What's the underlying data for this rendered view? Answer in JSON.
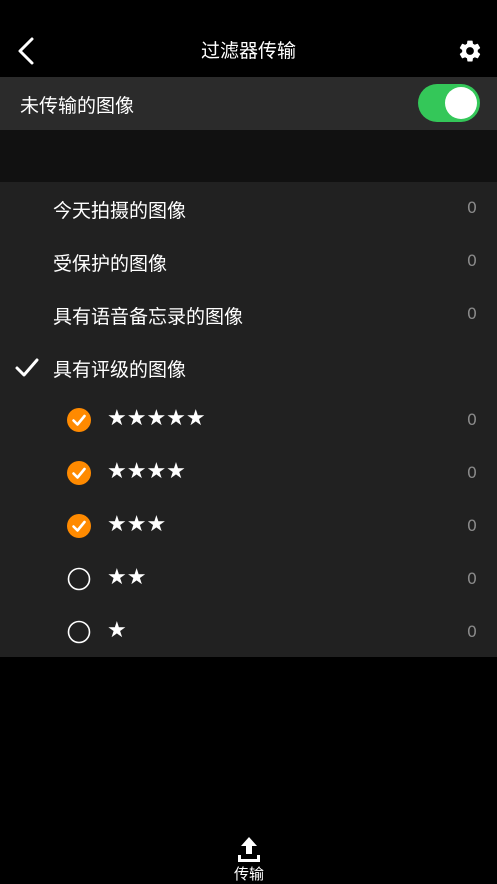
{
  "header": {
    "title": "过滤器传输"
  },
  "untransferred": {
    "label": "未传输的图像",
    "enabled": true
  },
  "filters": [
    {
      "label": "今天拍摄的图像",
      "count": "0",
      "checked": false
    },
    {
      "label": "受保护的图像",
      "count": "0",
      "checked": false
    },
    {
      "label": "具有语音备忘录的图像",
      "count": "0",
      "checked": false
    },
    {
      "label": "具有评级的图像",
      "count": "",
      "checked": true
    }
  ],
  "ratings": [
    {
      "stars": "★★★★★",
      "count": "0",
      "checked": true
    },
    {
      "stars": "★★★★",
      "count": "0",
      "checked": true
    },
    {
      "stars": "★★★",
      "count": "0",
      "checked": true
    },
    {
      "stars": "★★",
      "count": "0",
      "checked": false
    },
    {
      "stars": "★",
      "count": "0",
      "checked": false
    }
  ],
  "footer": {
    "transfer_label": "传输"
  },
  "colors": {
    "accent": "#ff8a00",
    "toggle_on": "#34c759",
    "list_bg": "#212121"
  },
  "icons": {
    "back": "chevron-left-icon",
    "settings": "gear-icon",
    "check": "checkmark-icon",
    "upload": "upload-icon"
  }
}
